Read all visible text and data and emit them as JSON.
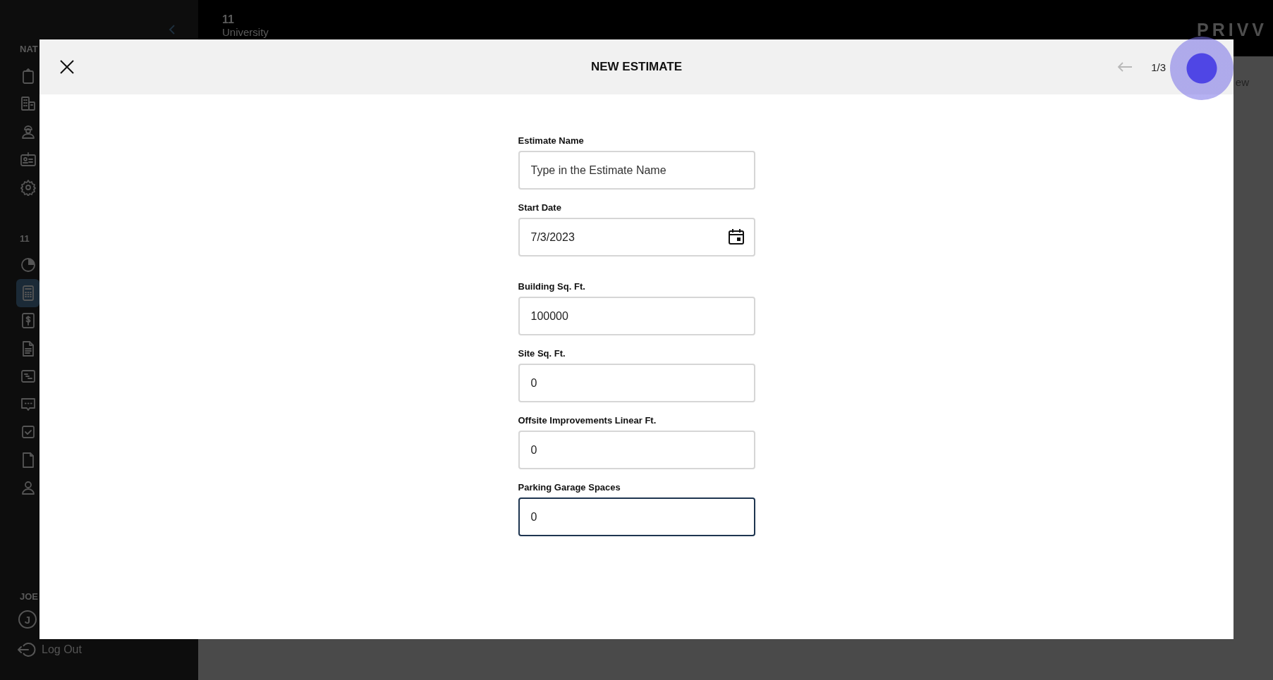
{
  "sidebar": {
    "sections": [
      {
        "label": "NAT",
        "items": [
          {
            "selected": false
          },
          {
            "selected": false
          },
          {
            "selected": false
          },
          {
            "selected": false
          },
          {
            "selected": false
          }
        ]
      },
      {
        "label": "11",
        "items": [
          {
            "selected": false
          },
          {
            "selected": true
          },
          {
            "selected": false
          },
          {
            "selected": false
          },
          {
            "selected": false
          },
          {
            "selected": false
          },
          {
            "selected": false
          },
          {
            "selected": false
          },
          {
            "selected": false
          }
        ]
      },
      {
        "label": "JOE"
      }
    ],
    "user_initial": "J",
    "logout": "Log Out"
  },
  "topbar": {
    "project_number": "11",
    "project_name": "University",
    "logo": "PRIVV"
  },
  "main": {
    "button_fragment": "ew"
  },
  "modal": {
    "title": "NEW ESTIMATE",
    "page": "1/3",
    "back_disabled": true,
    "fields": [
      {
        "kind": "text",
        "label": "Estimate Name",
        "placeholder": "Type in the Estimate Name",
        "focused": false
      },
      {
        "kind": "date",
        "label": "Start Date",
        "value": "7/3/2023",
        "focused": false
      },
      {
        "kind": "text",
        "label": "Building Sq. Ft.",
        "value": "100000",
        "focused": false
      },
      {
        "kind": "text",
        "label": "Site Sq. Ft.",
        "value": "0",
        "focused": false
      },
      {
        "kind": "text",
        "label": "Offsite Improvements Linear Ft.",
        "value": "0",
        "focused": false
      },
      {
        "kind": "text",
        "label": "Parking Garage Spaces",
        "value": "0",
        "focused": true
      }
    ]
  }
}
